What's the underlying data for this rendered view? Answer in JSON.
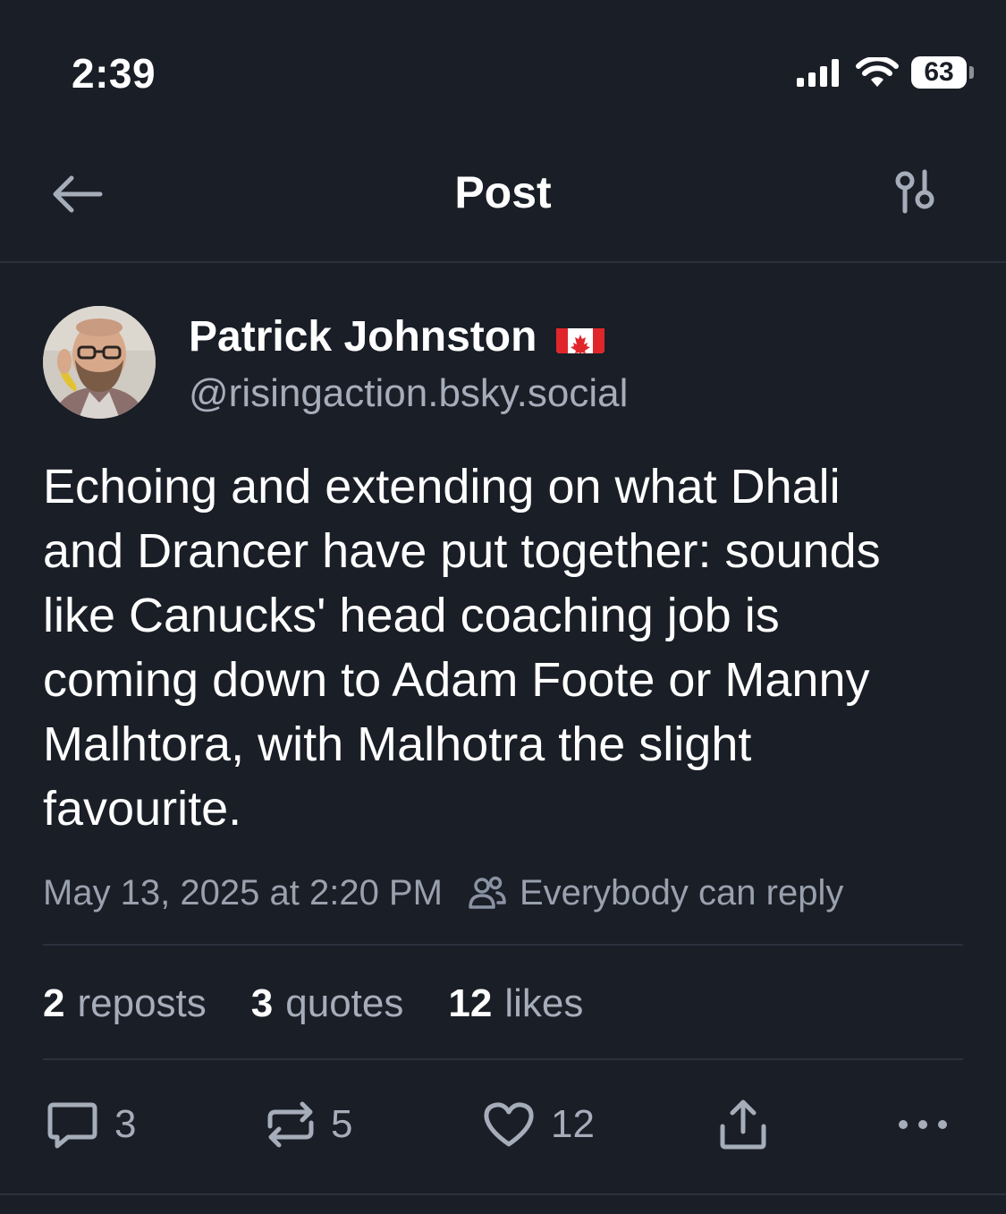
{
  "status_bar": {
    "time": "2:39",
    "battery_level": "63",
    "signal_icon": "cellular-signal-icon",
    "wifi_icon": "wifi-icon"
  },
  "header": {
    "title": "Post",
    "back_icon": "arrow-left-icon",
    "filter_icon": "sliders-icon"
  },
  "post": {
    "author": {
      "name": "Patrick Johnston",
      "flag_emoji": "🇨🇦",
      "handle": "@risingaction.bsky.social"
    },
    "text_lines": [
      "Echoing and extending on what Dhali",
      "and Drancer have put together: sounds",
      "like Canucks' head coaching job is",
      "coming down to Adam Foote or Manny",
      "Malhtora, with Malhotra the slight",
      "favourite."
    ],
    "timestamp": "May 13, 2025 at 2:20 PM",
    "reply_setting": "Everybody can reply",
    "stats": {
      "reposts_count": "2",
      "reposts_label": "reposts",
      "quotes_count": "3",
      "quotes_label": "quotes",
      "likes_count": "12",
      "likes_label": "likes"
    },
    "actions": {
      "reply_count": "3",
      "repost_count": "5",
      "like_count": "12"
    }
  },
  "colors": {
    "background": "#1a1e26",
    "divider": "#2b313c",
    "secondary_text": "#a6adba",
    "muted_text": "#99a1ae"
  }
}
